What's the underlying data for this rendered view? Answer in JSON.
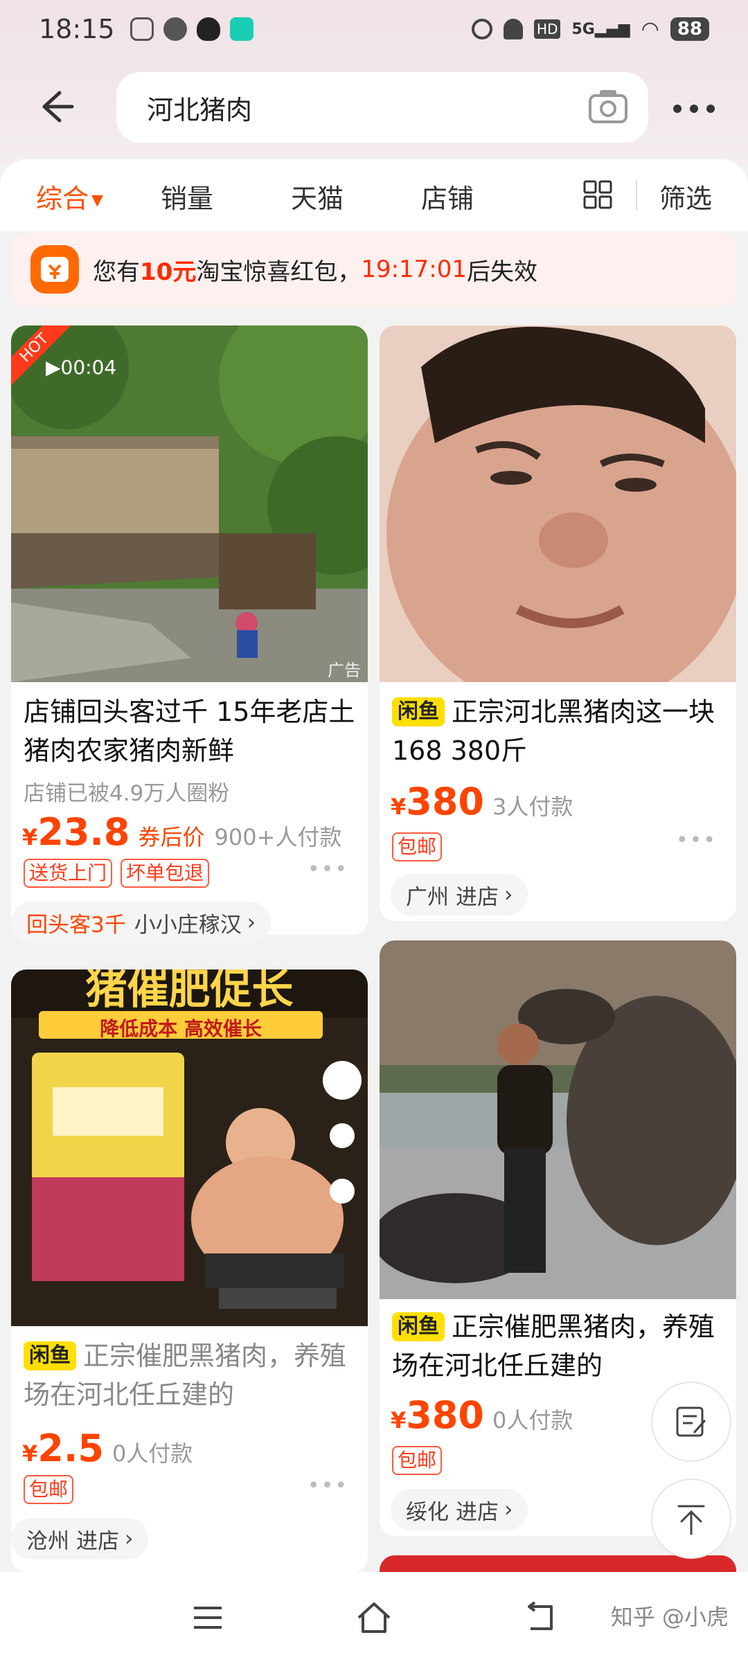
{
  "status_bar": {
    "time": "18:15",
    "network": "5G",
    "battery": "88"
  },
  "search": {
    "back_icon": "back-arrow-icon",
    "query": "河北猪肉",
    "camera_icon": "camera-icon",
    "more_icon": "more-icon"
  },
  "tabs": {
    "items": [
      "综合",
      "销量",
      "天猫",
      "店铺"
    ],
    "active": "综合",
    "filter_label": "筛选"
  },
  "banner": {
    "prefix": "您有",
    "amount": "10元",
    "middle": "淘宝惊喜红包，",
    "countdown": "19:17:01",
    "suffix": "后失效"
  },
  "products": [
    {
      "hot_tag": "HOT",
      "video_duration": "00:04",
      "ad_tag": "广告",
      "title": "店铺回头客过千 15年老店土猪肉农家猪肉新鲜",
      "subtitle": "店铺已被4.9万人圈粉",
      "currency": "¥",
      "price": "23.8",
      "coupon_label": "券后价",
      "sold": "900+人付款",
      "badges": [
        "送货上门",
        "坏单包退"
      ],
      "shop_highlight": "回头客3千",
      "shop_name": "小小庄稼汉"
    },
    {
      "platform_tag": "闲鱼",
      "title": "正宗河北黑猪肉这一块168 380斤",
      "currency": "¥",
      "price": "380",
      "sold": "3人付款",
      "badges": [
        "包邮"
      ],
      "shop_location": "广州",
      "shop_action": "进店"
    },
    {
      "platform_tag": "闲鱼",
      "image_text": "猪催肥促长",
      "image_banner": "降低成本 高效催长",
      "title": "正宗催肥黑猪肉，养殖场在河北任丘建的",
      "currency": "¥",
      "price": "2.5",
      "sold": "0人付款",
      "badges": [
        "包邮"
      ],
      "shop_location": "沧州",
      "shop_action": "进店"
    },
    {
      "platform_tag": "闲鱼",
      "title": "正宗催肥黑猪肉，养殖场在河北任丘建的",
      "currency": "¥",
      "price": "380",
      "sold": "0人付款",
      "badges": [
        "包邮"
      ],
      "shop_location": "绥化",
      "shop_action": "进店"
    }
  ],
  "watermark": "知乎 @小虎"
}
